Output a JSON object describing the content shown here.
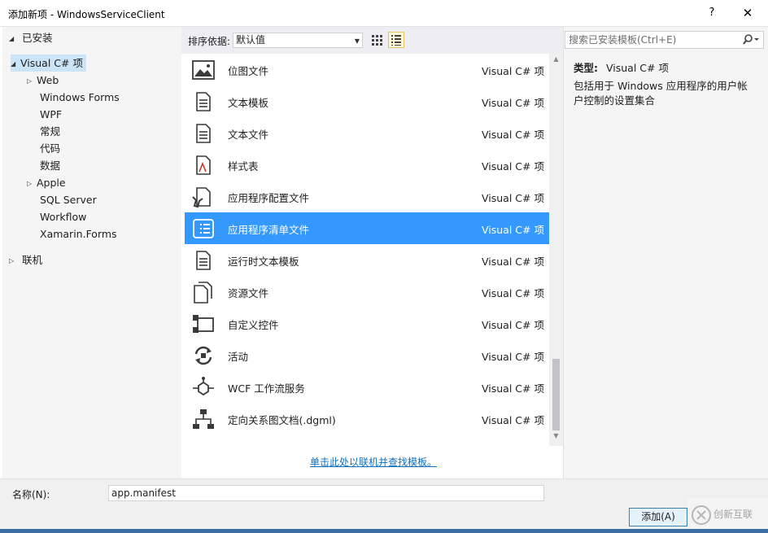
{
  "window": {
    "title": "添加新项 - WindowsServiceClient",
    "help_label": "?",
    "close_label": "✕"
  },
  "left_panel": {
    "installed_label": "已安装",
    "tree": [
      {
        "label": "Visual C# 项",
        "arrow": "◢",
        "selected": true
      },
      {
        "label": "Web",
        "arrow": "▷"
      },
      {
        "label": "Windows Forms"
      },
      {
        "label": "WPF"
      },
      {
        "label": "常规"
      },
      {
        "label": "代码"
      },
      {
        "label": "数据"
      },
      {
        "label": "Apple",
        "arrow": "▷"
      },
      {
        "label": "SQL Server"
      },
      {
        "label": "Workflow"
      },
      {
        "label": "Xamarin.Forms"
      }
    ],
    "online_label": "联机"
  },
  "toolbar": {
    "sort_label": "排序依据:",
    "sort_value": "默认值"
  },
  "templates": [
    {
      "name": "位图文件",
      "type": "Visual C# 项",
      "icon": "bitmap-icon"
    },
    {
      "name": "文本模板",
      "type": "Visual C# 项",
      "icon": "text-template-icon"
    },
    {
      "name": "文本文件",
      "type": "Visual C# 项",
      "icon": "text-file-icon"
    },
    {
      "name": "样式表",
      "type": "Visual C# 项",
      "icon": "stylesheet-icon"
    },
    {
      "name": "应用程序配置文件",
      "type": "Visual C# 项",
      "icon": "config-file-icon"
    },
    {
      "name": "应用程序清单文件",
      "type": "Visual C# 项",
      "icon": "manifest-file-icon",
      "selected": true
    },
    {
      "name": "运行时文本模板",
      "type": "Visual C# 项",
      "icon": "runtime-template-icon"
    },
    {
      "name": "资源文件",
      "type": "Visual C# 项",
      "icon": "resource-file-icon"
    },
    {
      "name": "自定义控件",
      "type": "Visual C# 项",
      "icon": "custom-control-icon"
    },
    {
      "name": "活动",
      "type": "Visual C# 项",
      "icon": "activity-icon"
    },
    {
      "name": "WCF 工作流服务",
      "type": "Visual C# 项",
      "icon": "wcf-workflow-icon"
    },
    {
      "name": "定向关系图文档(.dgml)",
      "type": "Visual C# 项",
      "icon": "dgml-icon"
    }
  ],
  "online_link": "单击此处以联机并查找模板。",
  "right_panel": {
    "search_placeholder": "搜索已安装模板(Ctrl+E)",
    "type_label": "类型:",
    "type_value": "Visual C# 项",
    "description": "包括用于 Windows 应用程序的用户帐户控制的设置集合"
  },
  "bottom": {
    "name_label": "名称(N):",
    "name_value": "app.manifest",
    "add_button": "添加(A)",
    "watermark": "创新互联"
  },
  "colors": {
    "selection": "#3399ff",
    "tree_selection": "#cce4f7",
    "link": "#0e70c0"
  }
}
